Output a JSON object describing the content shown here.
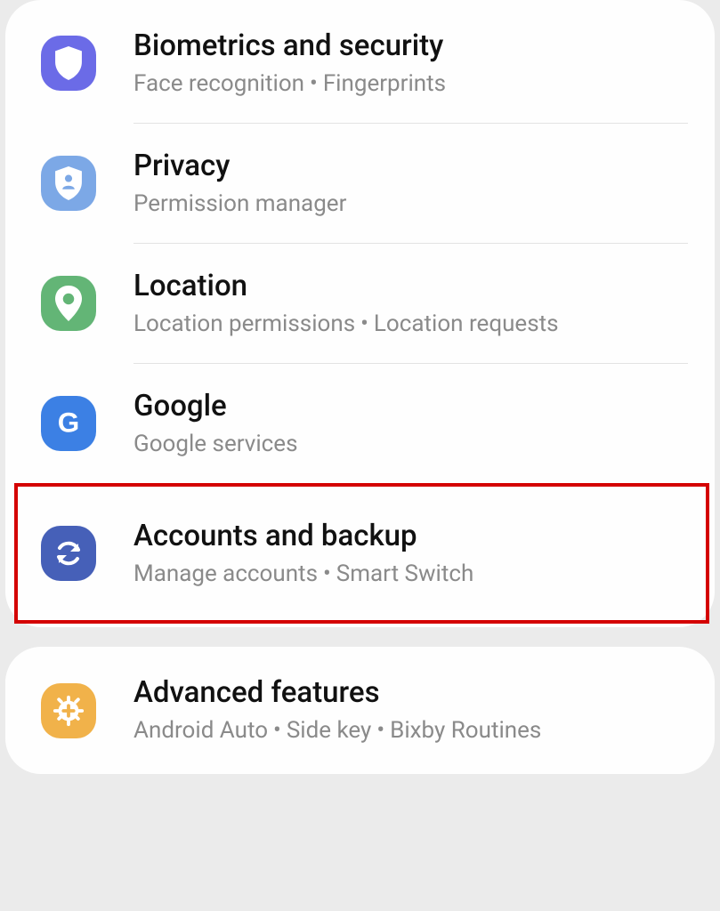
{
  "bullet": "•",
  "groups": [
    {
      "items": [
        {
          "id": "biometrics",
          "title": "Biometrics and security",
          "sub": [
            "Face recognition",
            "Fingerprints"
          ],
          "iconBg": "#6B6BE7",
          "highlight": false
        },
        {
          "id": "privacy",
          "title": "Privacy",
          "sub": [
            "Permission manager"
          ],
          "iconBg": "#7CA8E6",
          "highlight": false
        },
        {
          "id": "location",
          "title": "Location",
          "sub": [
            "Location permissions",
            "Location requests"
          ],
          "iconBg": "#63B576",
          "highlight": false
        },
        {
          "id": "google",
          "title": "Google",
          "sub": [
            "Google services"
          ],
          "iconBg": "#3C80E4",
          "highlight": false
        },
        {
          "id": "accounts",
          "title": "Accounts and backup",
          "sub": [
            "Manage accounts",
            "Smart Switch"
          ],
          "iconBg": "#4660B8",
          "highlight": true
        }
      ]
    },
    {
      "items": [
        {
          "id": "advanced",
          "title": "Advanced features",
          "sub": [
            "Android Auto",
            "Side key",
            "Bixby Routines"
          ],
          "iconBg": "#F1B24A",
          "highlight": false
        }
      ]
    }
  ]
}
